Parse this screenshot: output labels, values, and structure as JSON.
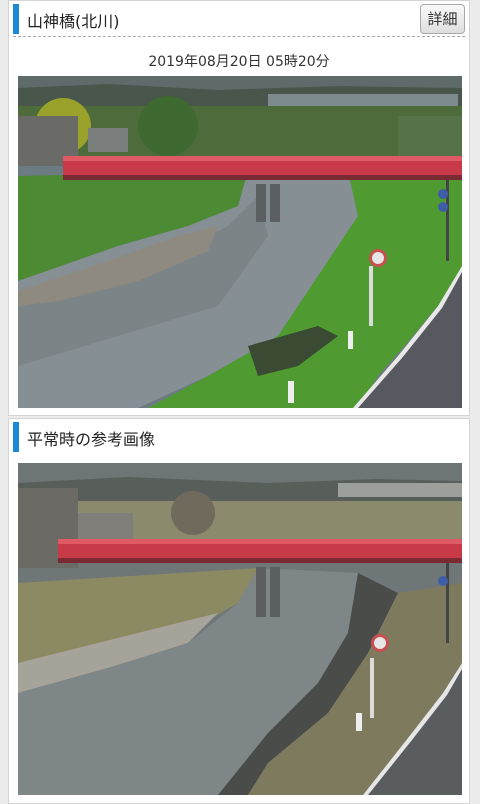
{
  "live_camera": {
    "title": "山神橋(北川)",
    "detail_button": "詳細",
    "timestamp": "2019年08月20日 05時20分"
  },
  "reference": {
    "title": "平常時の参考画像"
  }
}
